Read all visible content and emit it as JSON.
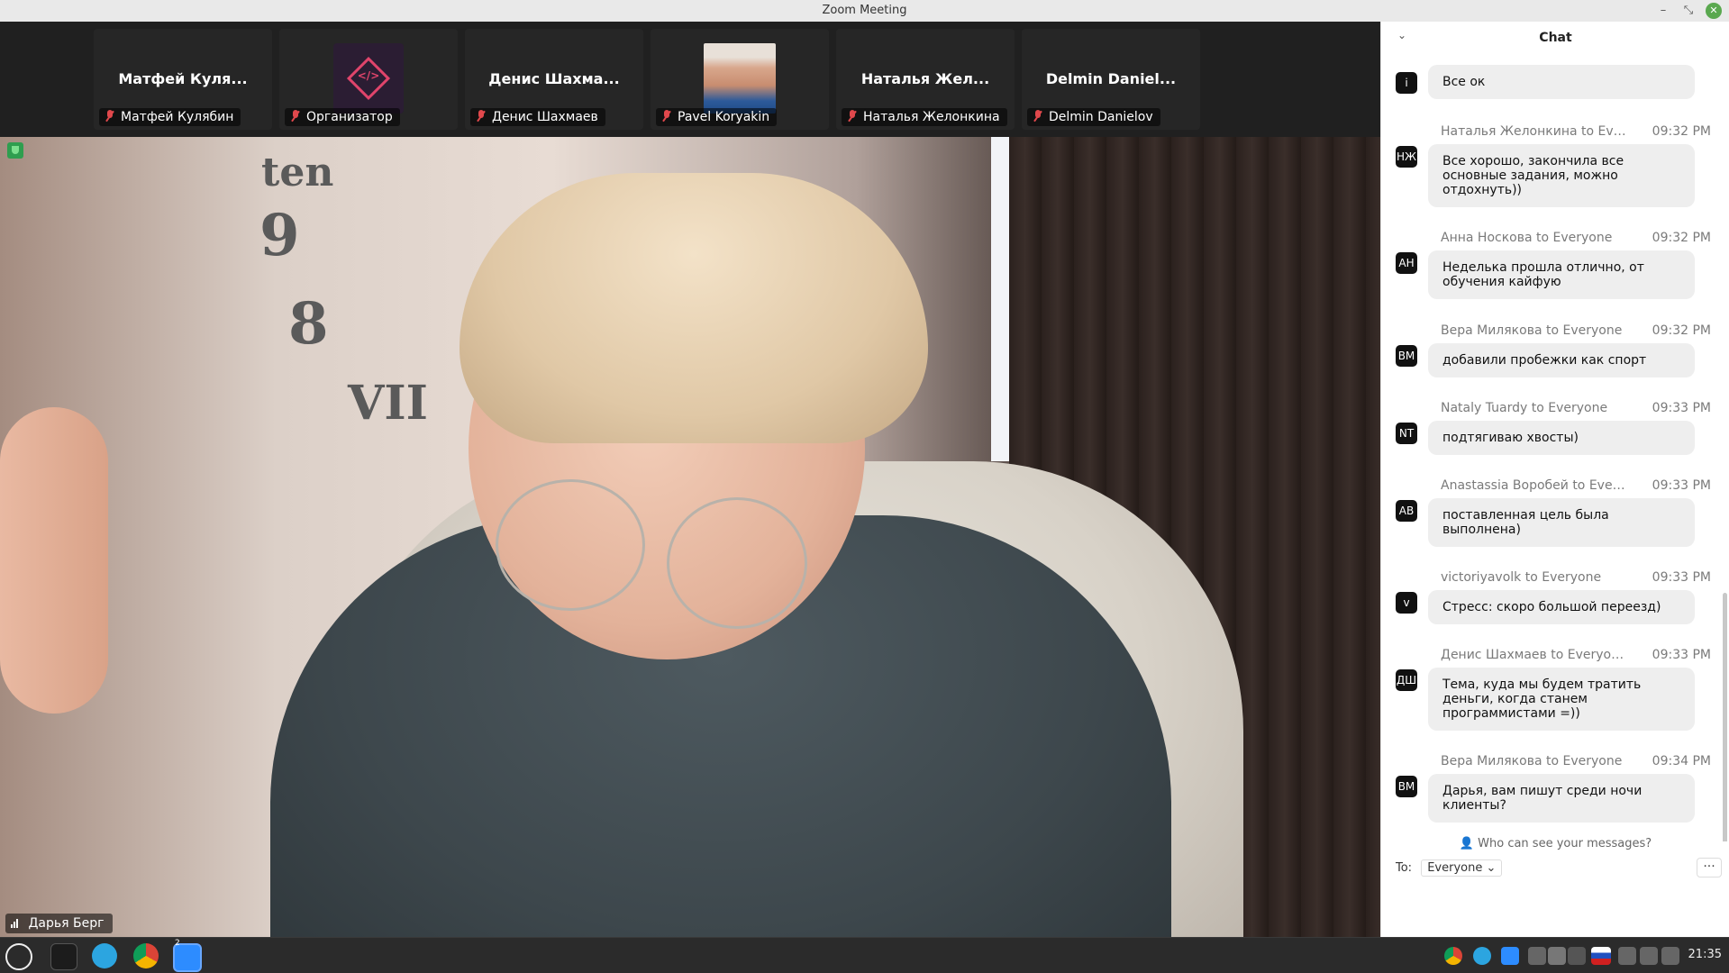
{
  "window": {
    "title": "Zoom Meeting"
  },
  "participants": [
    {
      "display": "Матфей Куля...",
      "label": "Матфей Кулябин"
    },
    {
      "display": "",
      "label": "Организатор"
    },
    {
      "display": "Денис Шахма...",
      "label": "Денис Шахмаев"
    },
    {
      "display": "",
      "label": "Pavel Koryakin"
    },
    {
      "display": "Наталья Жел...",
      "label": "Наталья Желонкина"
    },
    {
      "display": "Delmin Daniel...",
      "label": "Delmin Danielov"
    }
  ],
  "organizer_logo": {
    "glyph": "</>"
  },
  "active_speaker": {
    "name": "Дарья Берг"
  },
  "wall_numbers": [
    "ten",
    "9",
    "8",
    "VII"
  ],
  "chat": {
    "title": "Chat",
    "messages": [
      {
        "avatar": "i",
        "from": "",
        "time": "",
        "text": "Все ок"
      },
      {
        "avatar": "НЖ",
        "from": "Наталья Желонкина to Eve...",
        "time": "09:32 PM",
        "text": "Все хорошо, закончила все основные задания, можно отдохнуть))"
      },
      {
        "avatar": "АН",
        "from": "Анна Носкова to Everyone",
        "time": "09:32 PM",
        "text": "Неделька прошла отлично, от обучения кайфую"
      },
      {
        "avatar": "ВМ",
        "from": "Вера Милякова to Everyone",
        "time": "09:32 PM",
        "text": "добавили пробежки как спорт"
      },
      {
        "avatar": "NT",
        "from": "Nataly Tuardy to Everyone",
        "time": "09:33 PM",
        "text": "подтягиваю хвосты)"
      },
      {
        "avatar": "АВ",
        "from": "Anastassia Воробей to Ever...",
        "time": "09:33 PM",
        "text": "поставленная цель была выполнена)"
      },
      {
        "avatar": "v",
        "from": "victoriyavolk to Everyone",
        "time": "09:33 PM",
        "text": "Стресс: скоро большой переезд)"
      },
      {
        "avatar": "ДШ",
        "from": "Денис Шахмаев to Everyone",
        "time": "09:33 PM",
        "text": "Тема, куда мы будем тратить деньги, когда станем программистами =))"
      },
      {
        "avatar": "ВМ",
        "from": "Вера Милякова to Everyone",
        "time": "09:34 PM",
        "text": "Дарья, вам пишут среди ночи клиенты?"
      }
    ],
    "who_can_see": "Who can see your messages?",
    "to_label": "To:",
    "recipient": "Everyone",
    "more": "···"
  },
  "taskbar": {
    "clock": "21:35",
    "zoom_badge": "2"
  },
  "colors": {
    "accent_green": "#2f9e4f",
    "mic_muted": "#e0484c",
    "chat_bg": "#ffffff",
    "bubble_bg": "#eeeeee"
  }
}
